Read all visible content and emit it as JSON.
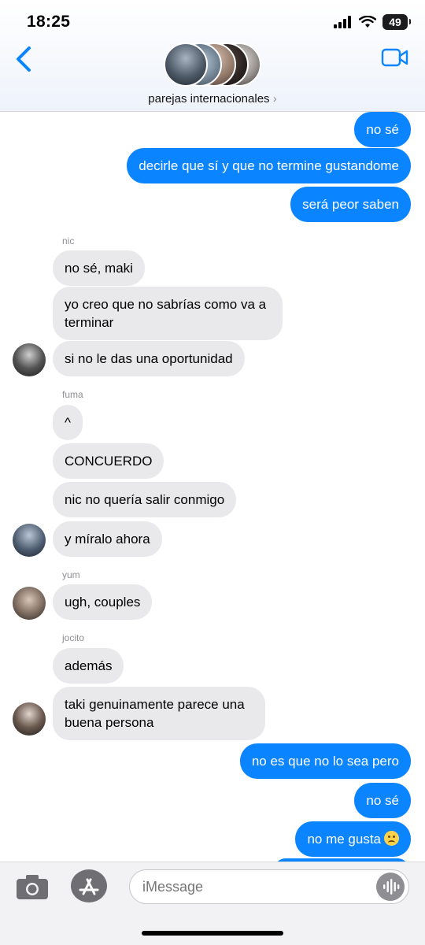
{
  "status_bar": {
    "time": "18:25",
    "battery": "49"
  },
  "header": {
    "group_name": "parejas internacionales",
    "group_chevron": "›"
  },
  "messages": [
    {
      "dir": "out",
      "text": "no sé"
    },
    {
      "dir": "out",
      "text": "decirle que sí y que no termine gustandome"
    },
    {
      "dir": "out",
      "text": "será peor saben"
    },
    {
      "dir": "in",
      "sender": "nic",
      "text": "no sé, maki"
    },
    {
      "dir": "in",
      "text": "yo creo que no sabrías como va a terminar"
    },
    {
      "dir": "in",
      "text": "si no le das una oportunidad"
    },
    {
      "dir": "in",
      "sender": "fuma",
      "text": "^"
    },
    {
      "dir": "in",
      "text": "CONCUERDO"
    },
    {
      "dir": "in",
      "text": "nic no quería salir conmigo"
    },
    {
      "dir": "in",
      "text": "y míralo ahora"
    },
    {
      "dir": "in",
      "sender": "yum",
      "text": "ugh, couples"
    },
    {
      "dir": "in",
      "sender": "jocito",
      "text": "además"
    },
    {
      "dir": "in",
      "text": "taki genuinamente parece una buena persona"
    },
    {
      "dir": "out",
      "text": "no es que no lo sea pero"
    },
    {
      "dir": "out",
      "text": "no sé"
    },
    {
      "dir": "out",
      "text": "no me gusta",
      "emoji": "frowning-face"
    }
  ],
  "compose": {
    "placeholder": "iMessage"
  },
  "icons": {
    "back": "chevron-left-icon",
    "video": "video-camera-icon",
    "camera": "camera-icon",
    "apps": "app-store-icon",
    "voice": "waveform-icon"
  },
  "colors": {
    "outgoing_bubble": "#0a84ff",
    "incoming_bubble": "#e9e9eb",
    "accent": "#0a84ff"
  }
}
